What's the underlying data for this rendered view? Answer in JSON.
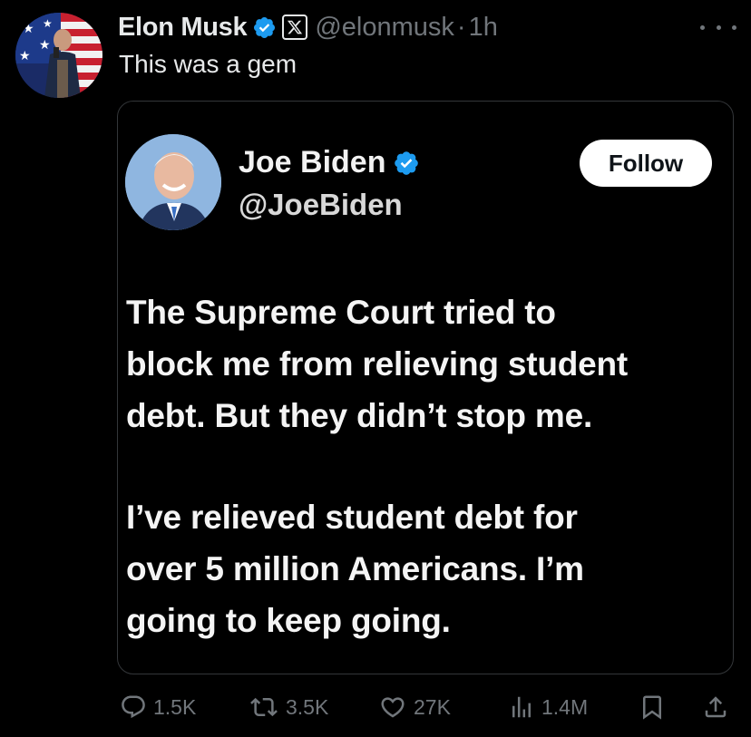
{
  "post": {
    "author_name": "Elon Musk",
    "handle": "@elonmusk",
    "separator": "·",
    "time": "1h",
    "text": "This was a gem"
  },
  "quoted_image": {
    "name": "Joe Biden",
    "handle": "@JoeBiden",
    "follow_label": "Follow",
    "paragraphs": [
      [
        "The Supreme Court tried to",
        "block me from relieving student",
        "debt. But they didn’t stop me."
      ],
      [
        "I’ve relieved student debt for",
        "over 5 million Americans. I’m",
        "going to keep going."
      ]
    ]
  },
  "actions": {
    "replies": "1.5K",
    "reposts": "3.5K",
    "likes": "27K",
    "views": "1.4M"
  },
  "colors": {
    "background": "#000000",
    "text_primary": "#e7e9ea",
    "text_secondary": "#71767b",
    "verified_blue": "#1d9bf0",
    "border": "#333639"
  },
  "icons": [
    "verified-badge-icon",
    "x-affiliation-icon",
    "more-icon",
    "reply-icon",
    "repost-icon",
    "like-icon",
    "views-icon",
    "bookmark-icon",
    "share-icon"
  ]
}
